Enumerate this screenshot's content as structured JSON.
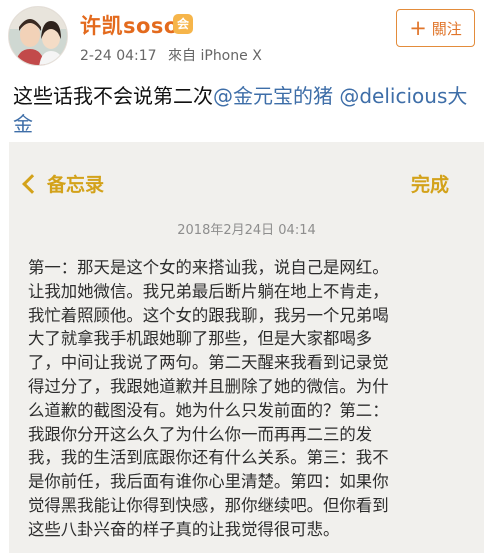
{
  "post": {
    "username": "许凯soso",
    "vip_badge": "会",
    "date": "2-24 04:17",
    "source": "來自 iPhone X",
    "follow_label": "關注",
    "text_prefix": "这些话我不会说第二次",
    "mention_1": "@金元宝的猪",
    "mention_2": "@delicious大金"
  },
  "memo": {
    "back_label": "备忘录",
    "done_label": "完成",
    "date": "2018年2月24日 04:14",
    "lines": [
      "第一：那天是这个女的来搭讪我，说自己是网红。",
      "让我加她微信。我兄弟最后断片躺在地上不肯走，",
      "我忙着照顾他。这个女的跟我聊，我另一个兄弟喝",
      "大了就拿我手机跟她聊了那些，但是大家都喝多",
      "了，中间让我说了两句。第二天醒来我看到记录觉",
      "得过分了，我跟她道歉并且删除了她的微信。为什",
      "么道歉的截图没有。她为什么只发前面的？第二：",
      "我跟你分开这么久了为什么你一而再再二三的发",
      "我，我的生活到底跟你还有什么关系。第三：我不",
      "是你前任，我后面有谁你心里清楚。第四：如果你",
      "觉得黑我能让你得到快感，那你继续吧。但你看到",
      "这些八卦兴奋的样子真的让我觉得很可悲。"
    ]
  },
  "colors": {
    "username": "#e36a1d",
    "follow": "#e0752a",
    "mention": "#3e6ea8",
    "memo_accent": "#d3a21a",
    "memo_bg": "#f1f0ed"
  }
}
